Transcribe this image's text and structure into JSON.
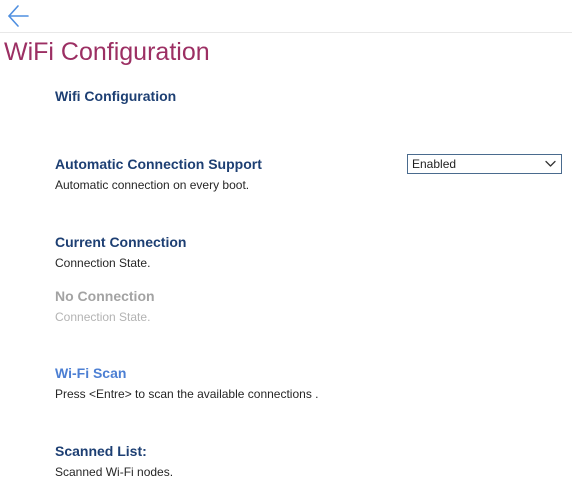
{
  "page": {
    "title": "WiFi Configuration"
  },
  "nav": {
    "back_icon": "back-arrow-icon"
  },
  "sections": {
    "header": {
      "title": "Wifi Configuration"
    },
    "auto_connect": {
      "title": "Automatic Connection Support",
      "description": "Automatic connection on every boot.",
      "select_value": "Enabled"
    },
    "current_connection": {
      "title": "Current Connection",
      "description": "Connection State."
    },
    "no_connection": {
      "title": "No Connection",
      "description": "Connection State."
    },
    "wifi_scan": {
      "title": "Wi-Fi Scan",
      "description": "Press <Entre> to scan the available connections ."
    },
    "scanned_list": {
      "title": "Scanned List:",
      "description": "Scanned Wi-Fi nodes."
    }
  },
  "colors": {
    "title": "#9c2f63",
    "heading": "#1d3f73",
    "link": "#4c7fd3",
    "disabled": "#a3a3a3",
    "back_arrow": "#4f8fe0"
  }
}
